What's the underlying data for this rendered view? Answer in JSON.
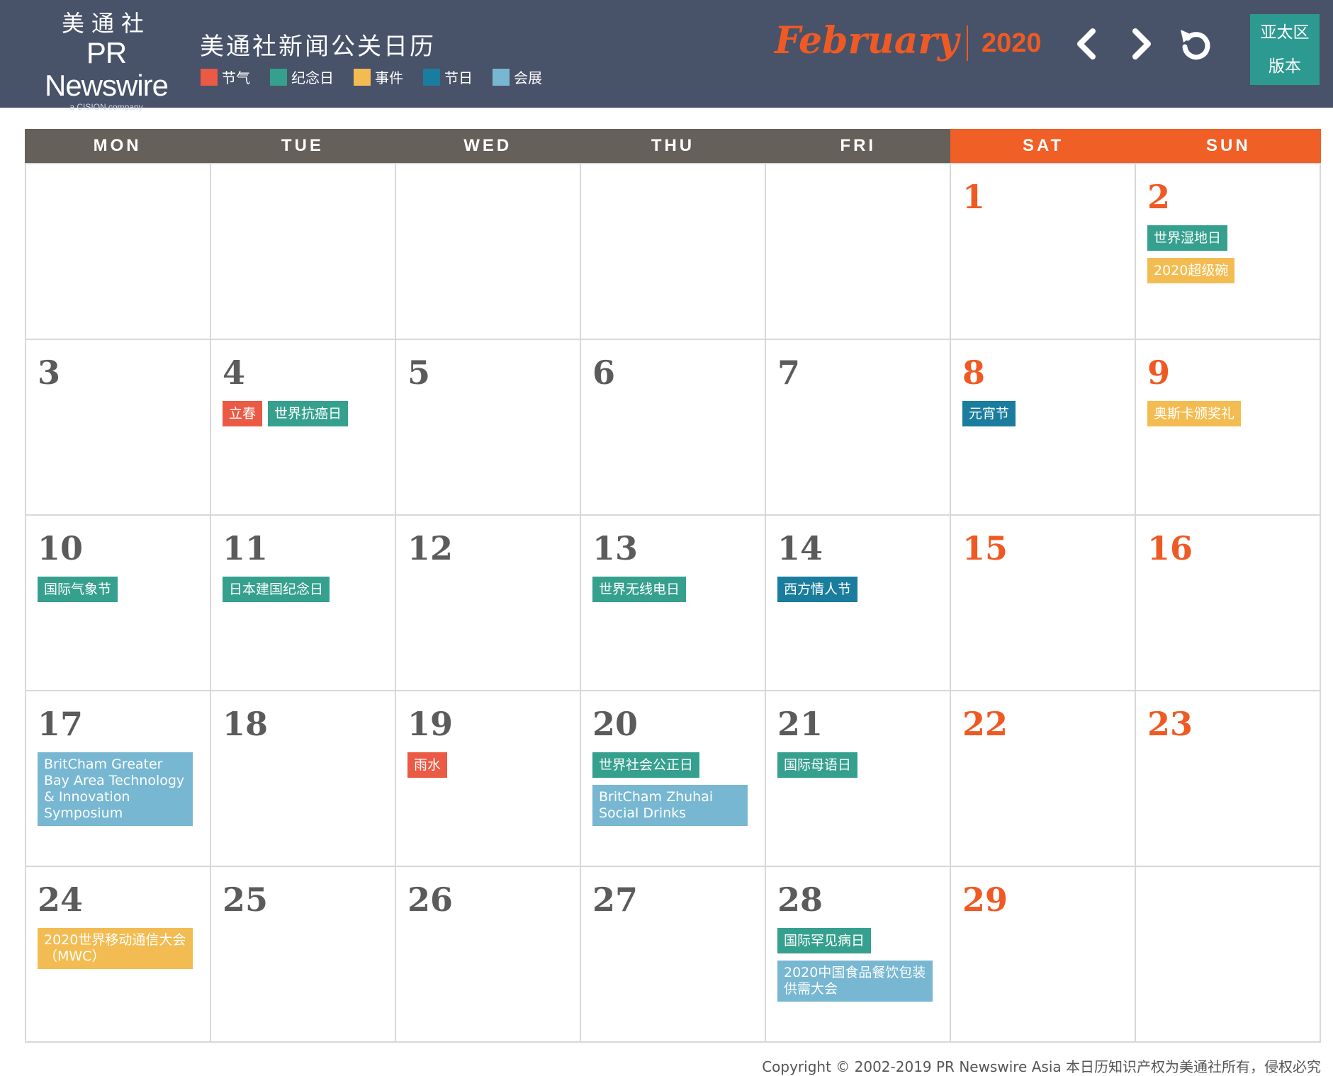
{
  "colors": {
    "header_bg": "#485269",
    "accent_orange": "#ef5a24",
    "weekday_header": "#66605a",
    "region_button": "#2d9a92",
    "solar_term": "#ea5a44",
    "commemoration": "#36a08e",
    "event": "#f3bc52",
    "festival": "#1a7d9d",
    "exhibition": "#77b7d2"
  },
  "header": {
    "logo": {
      "cn": "美通社",
      "en": "PR Newswire",
      "sub": "a CISION company"
    },
    "title": "美通社新闻公关日历",
    "legend": [
      {
        "label": "节气",
        "color": "#ea5a44"
      },
      {
        "label": "纪念日",
        "color": "#36a08e"
      },
      {
        "label": "事件",
        "color": "#f3bc52"
      },
      {
        "label": "节日",
        "color": "#1a7d9d"
      },
      {
        "label": "会展",
        "color": "#77b7d2"
      }
    ],
    "month": "February",
    "year": "2020",
    "nav": {
      "prev_icon": "chevron-left-icon",
      "next_icon": "chevron-right-icon",
      "reset_icon": "refresh-icon"
    },
    "region": {
      "line1": "亚太区",
      "line2": "版本"
    }
  },
  "calendar": {
    "weekdays": [
      "MON",
      "TUE",
      "WED",
      "THU",
      "FRI",
      "SAT",
      "SUN"
    ],
    "weeks": [
      [
        {
          "day": "",
          "events": []
        },
        {
          "day": "",
          "events": []
        },
        {
          "day": "",
          "events": []
        },
        {
          "day": "",
          "events": []
        },
        {
          "day": "",
          "events": []
        },
        {
          "day": "1",
          "events": []
        },
        {
          "day": "2",
          "events": [
            {
              "label": "世界湿地日",
              "type": "commemoration"
            },
            {
              "label": "2020超级碗",
              "type": "event"
            }
          ]
        }
      ],
      [
        {
          "day": "3",
          "events": []
        },
        {
          "day": "4",
          "events": [
            {
              "label": "立春",
              "type": "solar_term"
            },
            {
              "label": "世界抗癌日",
              "type": "commemoration"
            }
          ]
        },
        {
          "day": "5",
          "events": []
        },
        {
          "day": "6",
          "events": []
        },
        {
          "day": "7",
          "events": []
        },
        {
          "day": "8",
          "events": [
            {
              "label": "元宵节",
              "type": "festival"
            }
          ]
        },
        {
          "day": "9",
          "events": [
            {
              "label": "奥斯卡颁奖礼",
              "type": "event"
            }
          ]
        }
      ],
      [
        {
          "day": "10",
          "events": [
            {
              "label": "国际气象节",
              "type": "commemoration"
            }
          ]
        },
        {
          "day": "11",
          "events": [
            {
              "label": "日本建国纪念日",
              "type": "commemoration"
            }
          ]
        },
        {
          "day": "12",
          "events": []
        },
        {
          "day": "13",
          "events": [
            {
              "label": "世界无线电日",
              "type": "commemoration"
            }
          ]
        },
        {
          "day": "14",
          "events": [
            {
              "label": "西方情人节",
              "type": "festival"
            }
          ]
        },
        {
          "day": "15",
          "events": []
        },
        {
          "day": "16",
          "events": []
        }
      ],
      [
        {
          "day": "17",
          "events": [
            {
              "label": "BritCham Greater Bay Area Technology & Innovation Symposium",
              "type": "exhibition",
              "wide": true
            }
          ]
        },
        {
          "day": "18",
          "events": []
        },
        {
          "day": "19",
          "events": [
            {
              "label": "雨水",
              "type": "solar_term"
            }
          ]
        },
        {
          "day": "20",
          "events": [
            {
              "label": "世界社会公正日",
              "type": "commemoration"
            },
            {
              "label": "BritCham Zhuhai Social Drinks",
              "type": "exhibition",
              "wide": true
            }
          ]
        },
        {
          "day": "21",
          "events": [
            {
              "label": "国际母语日",
              "type": "commemoration"
            }
          ]
        },
        {
          "day": "22",
          "events": []
        },
        {
          "day": "23",
          "events": []
        }
      ],
      [
        {
          "day": "24",
          "events": [
            {
              "label": "2020世界移动通信大会（MWC）",
              "type": "event",
              "wide": true
            }
          ]
        },
        {
          "day": "25",
          "events": []
        },
        {
          "day": "26",
          "events": []
        },
        {
          "day": "27",
          "events": []
        },
        {
          "day": "28",
          "events": [
            {
              "label": "国际罕见病日",
              "type": "commemoration"
            },
            {
              "label": "2020中国食品餐饮包装供需大会",
              "type": "exhibition",
              "wide": true
            }
          ]
        },
        {
          "day": "29",
          "events": []
        },
        {
          "day": "",
          "events": []
        }
      ]
    ]
  },
  "footer": {
    "copyright": "Copyright © 2002-2019 PR Newswire Asia 本日历知识产权为美通社所有，侵权必究"
  }
}
